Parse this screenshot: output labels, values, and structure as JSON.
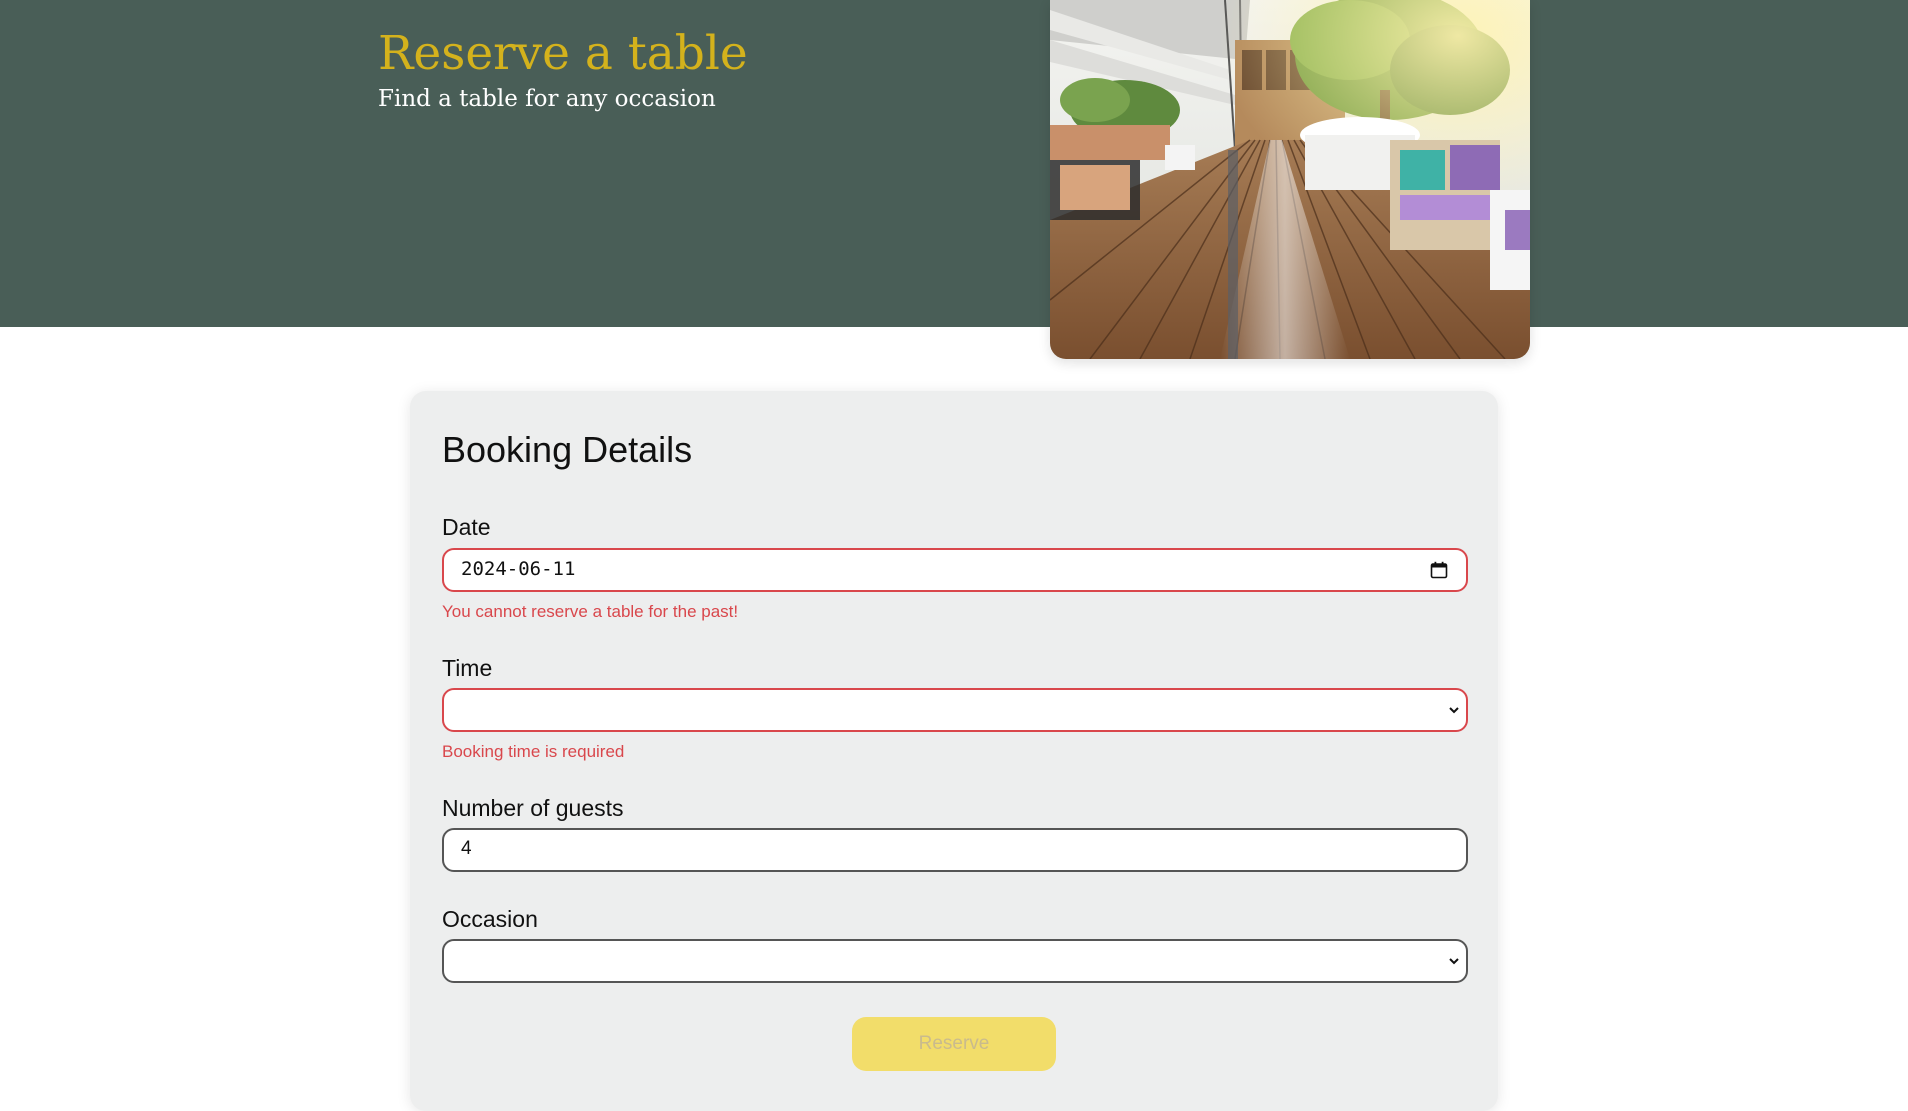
{
  "hero": {
    "title": "Reserve a table",
    "subtitle": "Find a table for any occasion",
    "image_alt": "Restaurant terrace with wooden deck"
  },
  "form": {
    "heading": "Booking Details",
    "date": {
      "label": "Date",
      "value": "2024-06-11",
      "error": "You cannot reserve a table for the past!"
    },
    "time": {
      "label": "Time",
      "value": "",
      "error": "Booking time is required"
    },
    "guests": {
      "label": "Number of guests",
      "value": "4"
    },
    "occasion": {
      "label": "Occasion",
      "value": ""
    },
    "submit_label": "Reserve"
  },
  "colors": {
    "hero_bg": "#495e57",
    "title_accent": "#d4b21c",
    "error": "#d9474c",
    "button_bg": "#f2dd6a",
    "card_bg": "#edeeee"
  },
  "icons": {
    "date_field": "calendar-icon",
    "select_field": "chevron-down-icon"
  }
}
